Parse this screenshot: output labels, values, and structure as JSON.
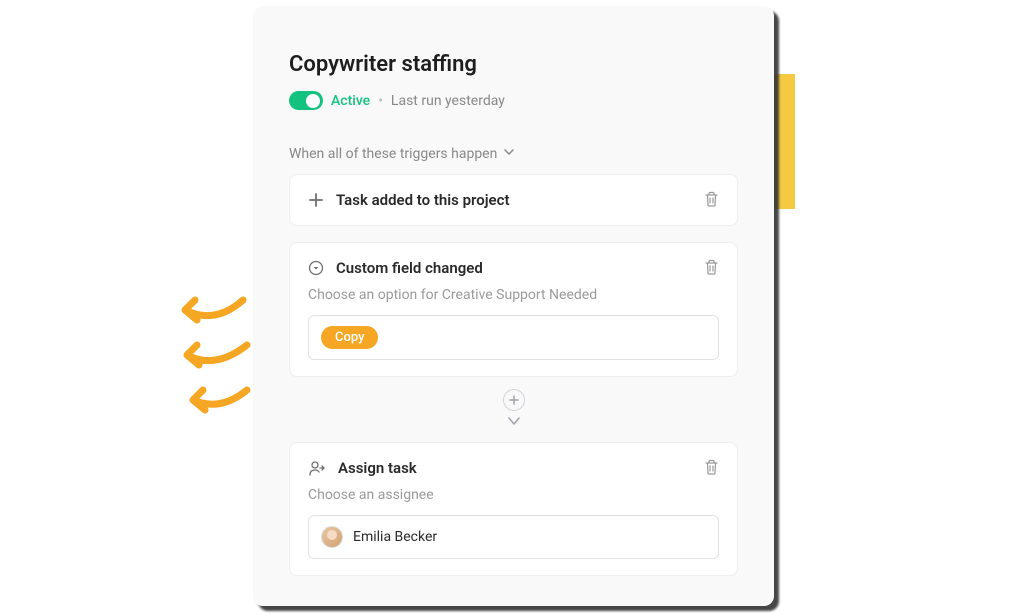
{
  "title": "Copywriter staffing",
  "status": {
    "active_label": "Active",
    "last_run": "Last run yesterday"
  },
  "subheading": "When all of these triggers happen",
  "trigger1": {
    "title": "Task added to this project"
  },
  "trigger2": {
    "title": "Custom field changed",
    "desc": "Choose an option for Creative Support Needed",
    "chip": "Copy"
  },
  "action": {
    "title": "Assign task",
    "desc": "Choose an assignee",
    "assignee": "Emilia Becker"
  }
}
